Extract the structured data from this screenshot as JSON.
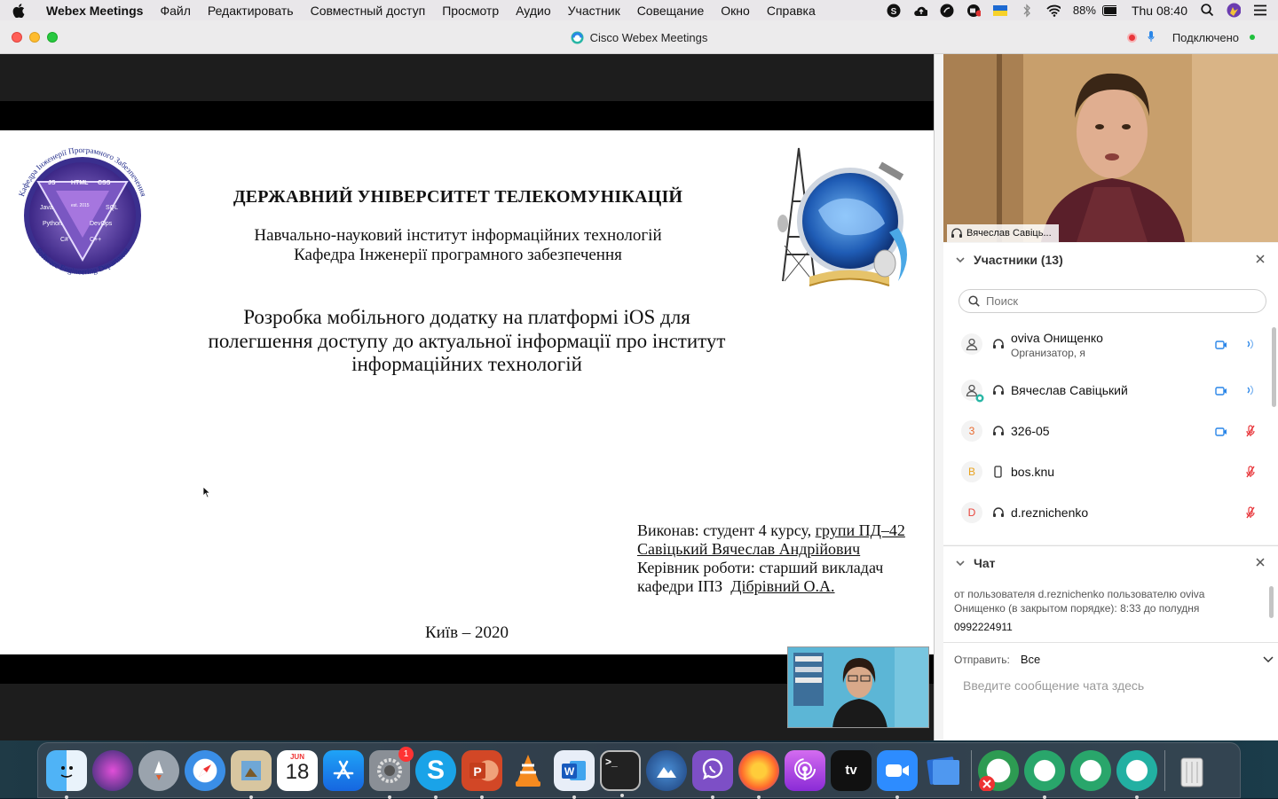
{
  "menubar": {
    "app_name": "Webex Meetings",
    "items": [
      "Файл",
      "Редактировать",
      "Совместный доступ",
      "Просмотр",
      "Аудио",
      "Участник",
      "Совещание",
      "Окно",
      "Справка"
    ],
    "battery": "88%",
    "clock": "Thu 08:40"
  },
  "window": {
    "title": "Cisco Webex Meetings",
    "status": "Подключено"
  },
  "slide": {
    "university": "ДЕРЖАВНИЙ УНІВЕРСИТЕТ ТЕЛЕКОМУНІКАЦІЙ",
    "institute_line1": "Навчально-науковий інститут інформаційних технологій",
    "institute_line2": "Кафедра Інженерії програмного забезпечення",
    "topic_line1": "Розробка мобільного додатку на платформі iOS для",
    "topic_line2": "полегшення доступу до актуальної інформації про інститут",
    "topic_line3": "інформаційних технологій",
    "author_prefix": "Виконав: студент 4 курсу, ",
    "author_group": "групи ПД–42",
    "author_name": "Савіцький Вячеслав Андрійович",
    "supervisor_line1": "Керівник роботи: старший викладач",
    "supervisor_prefix": "кафедри ІПЗ  ",
    "supervisor_name": "Дібрівний О.А.",
    "city_year": "Київ – 2020",
    "logo_left_text": {
      "ring_top": "Кафедра Інженерії Програмного Забезпечення",
      "ring_bottom": "Software Engineering Department",
      "langs": [
        "JS",
        "HTML",
        "CSS",
        "Java",
        "SQL",
        "Python",
        "DevOps",
        "C#",
        "C++"
      ],
      "est": "est. 2015"
    }
  },
  "self_video": {
    "name": "Вячеслав Савіць..."
  },
  "participants": {
    "title": "Участники (13)",
    "search_placeholder": "Поиск",
    "rows": [
      {
        "name": "oviva Онищенко",
        "role": "Организатор, я",
        "avatar": "",
        "avatar_color": "#555555",
        "camera": true,
        "mic": "on"
      },
      {
        "name": "Вячеслав Савіцький",
        "role": "",
        "avatar": "",
        "avatar_color": "#555555",
        "camera": true,
        "mic": "on"
      },
      {
        "name": "326-05",
        "role": "",
        "avatar": "3",
        "avatar_color": "#e8692e",
        "camera": true,
        "mic": "muted"
      },
      {
        "name": "bos.knu",
        "role": "",
        "avatar": "B",
        "avatar_color": "#e8a21f",
        "camera": false,
        "mic": "muted"
      },
      {
        "name": "d.reznichenko",
        "role": "",
        "avatar": "D",
        "avatar_color": "#e8453c",
        "camera": false,
        "mic": "muted"
      }
    ]
  },
  "chat": {
    "title": "Чат",
    "message_header": "от пользователя d.reznichenko пользователю oviva Онищенко (в закрытом порядке):   8:33  до полудня",
    "message_text": "0992224911",
    "send_to_label": "Отправить:",
    "send_to_value": "Все",
    "input_placeholder": "Введите сообщение чата здесь"
  },
  "dock": {
    "calendar_month": "JUN",
    "calendar_day": "18",
    "settings_badge": "1",
    "apps": [
      "finder-icon",
      "siri-icon",
      "launchpad-icon",
      "safari-icon",
      "preview-icon",
      "calendar-icon",
      "app-store-icon",
      "system-preferences-icon",
      "skype-icon",
      "powerpoint-icon",
      "vlc-icon",
      "word-icon",
      "terminal-icon",
      "macos-installer-icon",
      "viber-icon",
      "firefox-icon",
      "podcasts-icon",
      "apple-tv-icon",
      "zoom-icon",
      "files-icon",
      "webex-blocked-icon",
      "webex-icon",
      "webex-icon-2",
      "webex-meetings-icon",
      "trash-icon"
    ],
    "colors": {
      "accent": "#2a86e8",
      "muted": "#e8363b"
    }
  }
}
